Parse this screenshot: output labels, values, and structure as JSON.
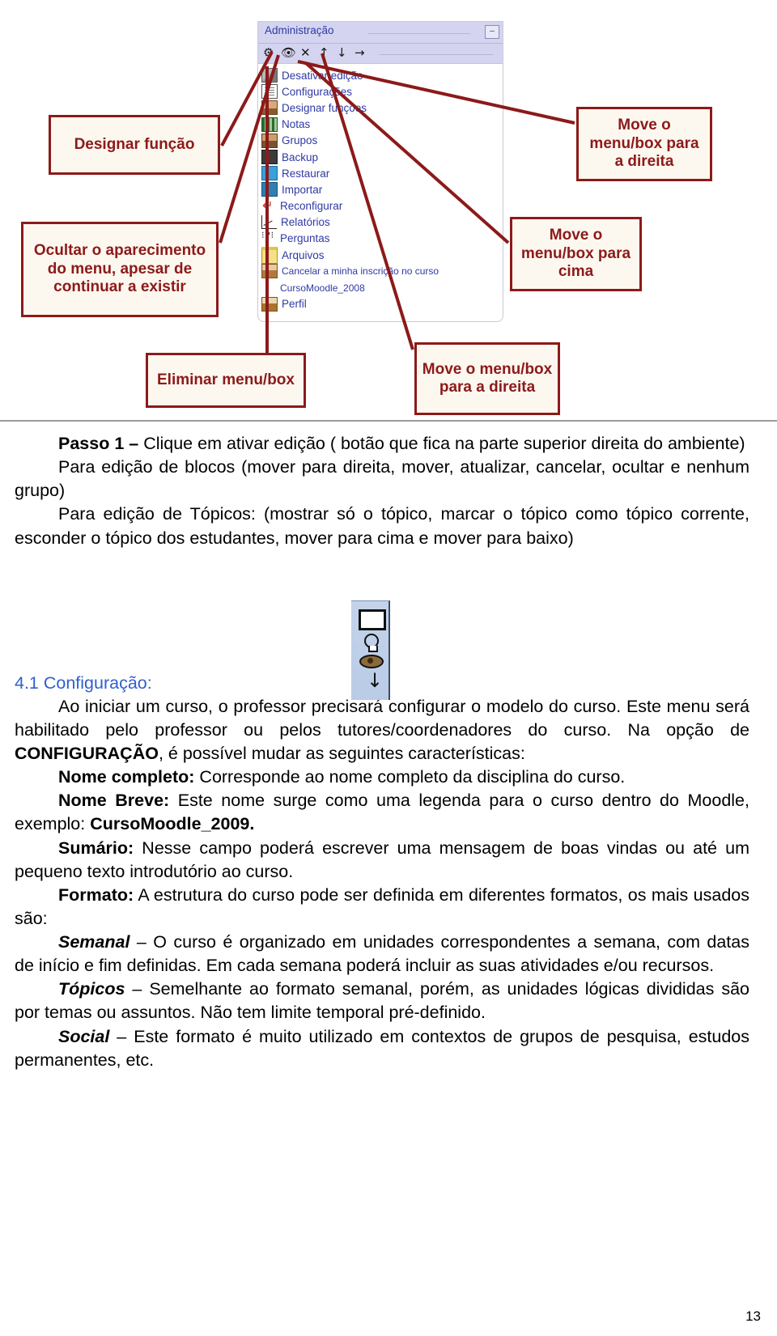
{
  "figure": {
    "block": {
      "title": "Administração",
      "minimize_label": "–",
      "toolbar_icons": [
        "assign-roles-icon",
        "hide-icon",
        "delete-icon",
        "move-up-icon",
        "move-down-icon",
        "move-right-icon"
      ],
      "items": [
        {
          "label": "Desativar edição",
          "icon": "pencil-icon"
        },
        {
          "label": "Configurações",
          "icon": "document-icon"
        },
        {
          "label": "Designar funções",
          "icon": "people-icon"
        },
        {
          "label": "Notas",
          "icon": "grades-icon"
        },
        {
          "label": "Grupos",
          "icon": "groups-icon"
        },
        {
          "label": "Backup",
          "icon": "backup-box-icon"
        },
        {
          "label": "Restaurar",
          "icon": "restore-box-icon"
        },
        {
          "label": "Importar",
          "icon": "import-box-icon"
        },
        {
          "label": "Reconfigurar",
          "icon": "reset-arrow-icon"
        },
        {
          "label": "Relatórios",
          "icon": "chart-icon"
        },
        {
          "label": "Perguntas",
          "icon": "quiz-icon"
        },
        {
          "label": "Arquivos",
          "icon": "folder-icon"
        },
        {
          "label": "Cancelar a minha inscrição no curso",
          "icon": "user-icon"
        },
        {
          "label": "CursoMoodle_2008",
          "icon": "none"
        },
        {
          "label": "Perfil",
          "icon": "profile-icon"
        }
      ]
    },
    "callouts": {
      "designar_funcao": "Designar função",
      "ocultar": "Ocultar o aparecimento do menu, apesar de continuar a existir",
      "move_direita": "Move o menu/box para a direita",
      "move_cima": "Move o menu/box para cima",
      "eliminar": "Eliminar menu/box",
      "move_direita_2": "Move o menu/box para a direita"
    },
    "accent_color": "#8c1a1a",
    "callout_fill": "#fdf8ef",
    "block_header_color": "#d4d4f0",
    "link_color": "#2f3aa3"
  },
  "text": {
    "passo1_label": "Passo 1 –",
    "passo1_rest": " Clique em ativar edição ( botão que fica na parte superior direita do ambiente)",
    "para_blocos": "Para edição de blocos (mover para direita, mover, atualizar, cancelar, ocultar e nenhum grupo)",
    "para_topicos": "Para edição de Tópicos: (mostrar só o tópico, marcar o tópico como tópico corrente, esconder o tópico dos estudantes, mover para cima e mover para baixo)",
    "heading_41": "4.1 Configuração:",
    "para_intro": "Ao iniciar um curso, o professor precisará configurar o modelo do curso. Este menu será habilitado pelo professor ou pelos tutores/coordenadores do curso. Na opção de ",
    "configuracao_bold": "CONFIGURAÇÃO",
    "para_intro_end": ", é possível mudar as seguintes características:",
    "nome_completo_label": "Nome completo:",
    "nome_completo_text": " Corresponde ao nome completo da disciplina do curso.",
    "nome_breve_label": "Nome Breve:",
    "nome_breve_text": " Este nome surge como uma legenda para o curso dentro do Moodle, exemplo: ",
    "nome_breve_example": "CursoMoodle_2009.",
    "sumario_label": "Sumário:",
    "sumario_text": " Nesse campo poderá escrever uma mensagem de boas vindas ou até um pequeno texto introdutório ao curso.",
    "formato_label": "Formato:",
    "formato_text": " A estrutura do curso pode ser definida em diferentes formatos, os mais usados são:",
    "semanal_label": "Semanal",
    "semanal_text": " – O curso é organizado em unidades correspondentes a semana, com datas de início e fim definidas. Em cada semana poderá incluir as suas atividades e/ou recursos.",
    "topicos_label": "Tópicos",
    "topicos_text": " – Semelhante ao formato semanal, porém, as unidades lógicas divididas são por temas ou assuntos. Não tem limite temporal pré-definido.",
    "social_label": "Social",
    "social_text": " – Este formato é muito utilizado em contextos de grupos de pesquisa, estudos permanentes, etc."
  },
  "mini_toolbar": {
    "icons": [
      "square-icon",
      "lightbulb-icon",
      "eye-icon",
      "down-arrow-icon"
    ]
  },
  "page_number": "13"
}
